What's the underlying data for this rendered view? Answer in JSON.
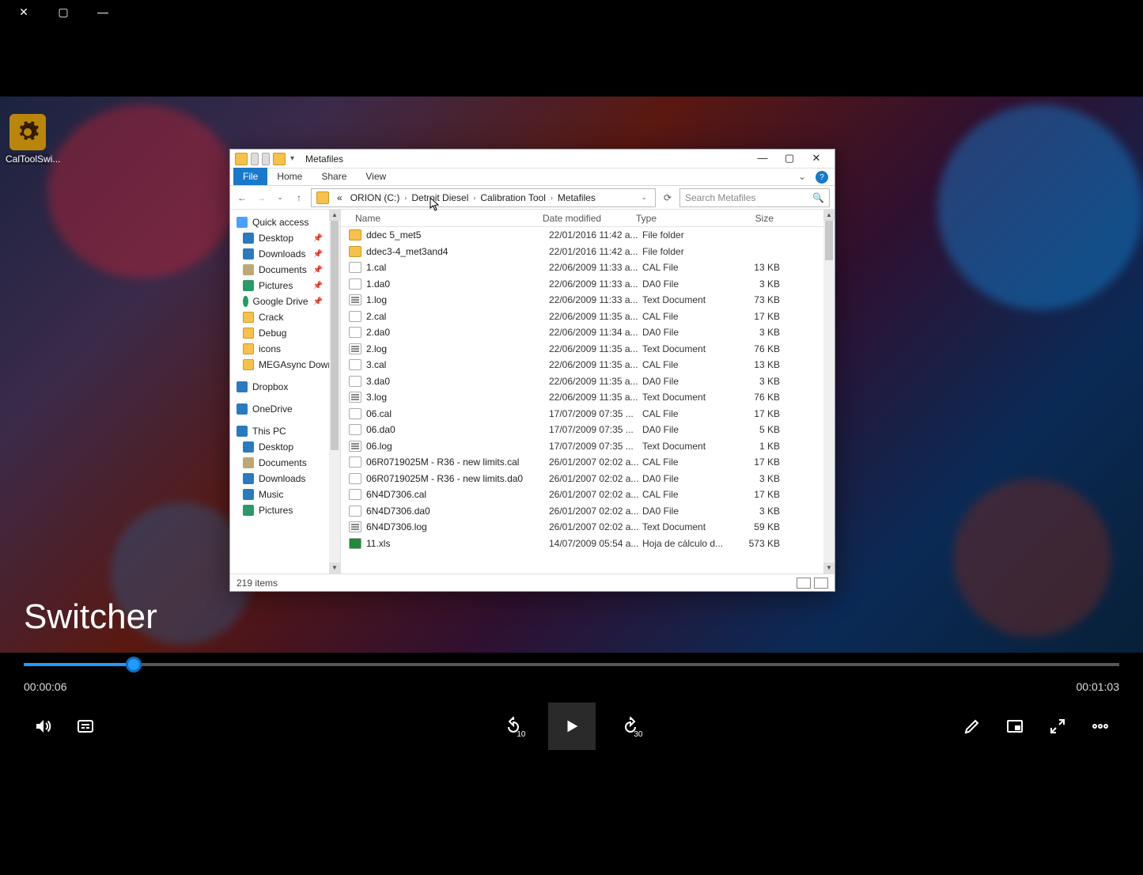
{
  "desktop_icon": {
    "label": "CalToolSwi..."
  },
  "explorer": {
    "title": "Metafiles",
    "tabs": {
      "file": "File",
      "home": "Home",
      "share": "Share",
      "view": "View"
    },
    "breadcrumb": {
      "prefix": "«",
      "parts": [
        "ORION (C:)",
        "Detroit Diesel",
        "Calibration Tool",
        "Metafiles"
      ]
    },
    "search_placeholder": "Search Metafiles",
    "columns": {
      "name": "Name",
      "date": "Date modified",
      "type": "Type",
      "size": "Size"
    },
    "nav": {
      "quick_access": "Quick access",
      "quick_items": [
        {
          "icon": "desk",
          "label": "Desktop",
          "pin": true
        },
        {
          "icon": "dl",
          "label": "Downloads",
          "pin": true
        },
        {
          "icon": "doc",
          "label": "Documents",
          "pin": true
        },
        {
          "icon": "pic",
          "label": "Pictures",
          "pin": true
        },
        {
          "icon": "gd",
          "label": "Google Drive",
          "pin": true
        },
        {
          "icon": "fld",
          "label": "Crack",
          "pin": false
        },
        {
          "icon": "fld",
          "label": "Debug",
          "pin": false
        },
        {
          "icon": "fld",
          "label": "icons",
          "pin": false
        },
        {
          "icon": "fld",
          "label": "MEGAsync Down",
          "pin": false
        }
      ],
      "dropbox": "Dropbox",
      "onedrive": "OneDrive",
      "thispc": "This PC",
      "pc_items": [
        {
          "icon": "desk",
          "label": "Desktop"
        },
        {
          "icon": "doc",
          "label": "Documents"
        },
        {
          "icon": "dl",
          "label": "Downloads"
        },
        {
          "icon": "mus",
          "label": "Music"
        },
        {
          "icon": "pic",
          "label": "Pictures"
        }
      ]
    },
    "files": [
      {
        "icon": "folder",
        "name": "ddec 5_met5",
        "date": "22/01/2016 11:42 a...",
        "type": "File folder",
        "size": ""
      },
      {
        "icon": "folder",
        "name": "ddec3-4_met3and4",
        "date": "22/01/2016 11:42 a...",
        "type": "File folder",
        "size": ""
      },
      {
        "icon": "file",
        "name": "1.cal",
        "date": "22/06/2009 11:33 a...",
        "type": "CAL File",
        "size": "13 KB"
      },
      {
        "icon": "file",
        "name": "1.da0",
        "date": "22/06/2009 11:33 a...",
        "type": "DA0 File",
        "size": "3 KB"
      },
      {
        "icon": "text",
        "name": "1.log",
        "date": "22/06/2009 11:33 a...",
        "type": "Text Document",
        "size": "73 KB"
      },
      {
        "icon": "file",
        "name": "2.cal",
        "date": "22/06/2009 11:35 a...",
        "type": "CAL File",
        "size": "17 KB"
      },
      {
        "icon": "file",
        "name": "2.da0",
        "date": "22/06/2009 11:34 a...",
        "type": "DA0 File",
        "size": "3 KB"
      },
      {
        "icon": "text",
        "name": "2.log",
        "date": "22/06/2009 11:35 a...",
        "type": "Text Document",
        "size": "76 KB"
      },
      {
        "icon": "file",
        "name": "3.cal",
        "date": "22/06/2009 11:35 a...",
        "type": "CAL File",
        "size": "13 KB"
      },
      {
        "icon": "file",
        "name": "3.da0",
        "date": "22/06/2009 11:35 a...",
        "type": "DA0 File",
        "size": "3 KB"
      },
      {
        "icon": "text",
        "name": "3.log",
        "date": "22/06/2009 11:35 a...",
        "type": "Text Document",
        "size": "76 KB"
      },
      {
        "icon": "file",
        "name": "06.cal",
        "date": "17/07/2009 07:35 ...",
        "type": "CAL File",
        "size": "17 KB"
      },
      {
        "icon": "file",
        "name": "06.da0",
        "date": "17/07/2009 07:35 ...",
        "type": "DA0 File",
        "size": "5 KB"
      },
      {
        "icon": "text",
        "name": "06.log",
        "date": "17/07/2009 07:35 ...",
        "type": "Text Document",
        "size": "1 KB"
      },
      {
        "icon": "file",
        "name": "06R0719025M - R36 - new limits.cal",
        "date": "26/01/2007 02:02 a...",
        "type": "CAL File",
        "size": "17 KB"
      },
      {
        "icon": "file",
        "name": "06R0719025M - R36 - new limits.da0",
        "date": "26/01/2007 02:02 a...",
        "type": "DA0 File",
        "size": "3 KB"
      },
      {
        "icon": "file",
        "name": "6N4D7306.cal",
        "date": "26/01/2007 02:02 a...",
        "type": "CAL File",
        "size": "17 KB"
      },
      {
        "icon": "file",
        "name": "6N4D7306.da0",
        "date": "26/01/2007 02:02 a...",
        "type": "DA0 File",
        "size": "3 KB"
      },
      {
        "icon": "text",
        "name": "6N4D7306.log",
        "date": "26/01/2007 02:02 a...",
        "type": "Text Document",
        "size": "59 KB"
      },
      {
        "icon": "xls",
        "name": "11.xls",
        "date": "14/07/2009 05:54 a...",
        "type": "Hoja de cálculo d...",
        "size": "573 KB"
      }
    ],
    "status": "219 items"
  },
  "overlay": {
    "title": "Switcher"
  },
  "player": {
    "elapsed": "00:00:06",
    "total": "00:01:03",
    "progress_pct": 10,
    "skip_back": "10",
    "skip_fwd": "30"
  }
}
